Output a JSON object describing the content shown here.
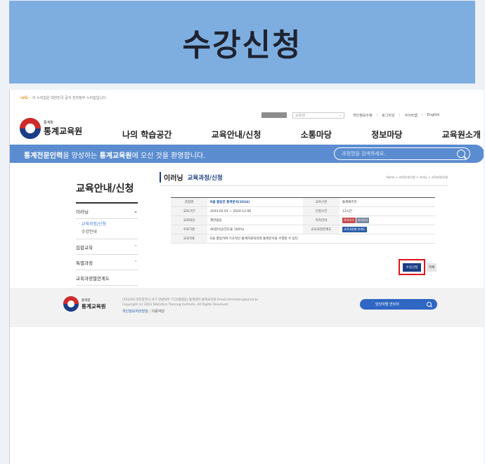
{
  "banner": {
    "title": "수강신청"
  },
  "notice": {
    "mark": "-eG-",
    "text": "이 누리집은 대한민국 공식 전자정부 누리집입니다."
  },
  "util": {
    "lang": "교육생",
    "links": [
      "개인정보수정",
      "로그아웃",
      "사이트맵",
      "English"
    ]
  },
  "logo": {
    "org": "통계청",
    "name": "통계교육원"
  },
  "gnb": [
    "나의 학습공간",
    "교육안내/신청",
    "소통마당",
    "정보마당",
    "교육원소개"
  ],
  "slogan": {
    "strong1": "통계전문인력",
    "mid": "을 양성하는 ",
    "strong2": "통계교육원",
    "rest": "에 오신 것을 환영합니다."
  },
  "search": {
    "placeholder": "과정명을 검색하세요."
  },
  "sidebar": {
    "title": "교육안내/신청",
    "items": [
      {
        "label": "이러닝",
        "open": true
      },
      {
        "label": "집합교육"
      },
      {
        "label": "특별과정"
      },
      {
        "label": "교육과정별연계도"
      }
    ],
    "sub": [
      "교육과정/신청",
      "수강안내"
    ]
  },
  "content": {
    "title1": "이러닝",
    "title2": "교육과정/신청",
    "breadcrumb": "Home > 교육안내/신청 > 이러닝 > 교육과정/신청"
  },
  "table": {
    "rows": [
      {
        "k1": "과정명",
        "v1": "R을 활용한 통계분석(2024)",
        "k2": "교육구분",
        "v2": "통계패키지"
      },
      {
        "k1": "교육기간",
        "v1": "2024.02.01 ~ 2024.12.06",
        "k2": "인정시간",
        "v2": "12시간"
      },
      {
        "k1": "교육대상",
        "v1": "제한없음",
        "k2": "학자안내",
        "v2": ""
      },
      {
        "k1": "수료기준",
        "v1": "90점이상(진도율 100%)",
        "k2": "교육과정연계도",
        "v2": ""
      },
      {
        "k1": "교육목표",
        "v1": "R을 활용하여 기초적인 통계자료처리와 통계분석을 수행할 수 있다."
      }
    ],
    "tags": {
      "a": "목차보기",
      "b": "미리보기",
      "c": "교육과정별 연계도"
    }
  },
  "buttons": {
    "apply": "수강신청",
    "list": "목록"
  },
  "footer": {
    "org": "통계청",
    "name": "통계교육원",
    "address": "(35220) 대전광역시 서구 한밭대로 713(월평동) 통계센터 통계교육원 Email:stimaster@korea.kr",
    "copyright": "Copyright (c) 2023 Statistics Training Institute. All Rights Reserved.",
    "privacy": "개인정보처리방침",
    "bar": "|",
    "terms": "이용약관",
    "site": "담당자별 연락처"
  }
}
